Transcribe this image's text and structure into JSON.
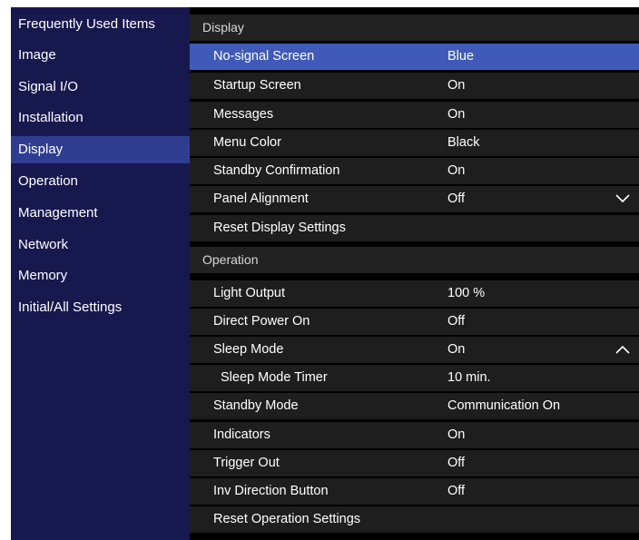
{
  "sidebar": {
    "items": [
      {
        "label": "Frequently Used Items",
        "active": false
      },
      {
        "label": "Image",
        "active": false
      },
      {
        "label": "Signal I/O",
        "active": false
      },
      {
        "label": "Installation",
        "active": false
      },
      {
        "label": "Display",
        "active": true
      },
      {
        "label": "Operation",
        "active": false
      },
      {
        "label": "Management",
        "active": false
      },
      {
        "label": "Network",
        "active": false
      },
      {
        "label": "Memory",
        "active": false
      },
      {
        "label": "Initial/All Settings",
        "active": false
      }
    ]
  },
  "display": {
    "header": "Display",
    "rows": [
      {
        "label": "No-signal Screen",
        "value": "Blue",
        "selected": true
      },
      {
        "label": "Startup Screen",
        "value": "On"
      },
      {
        "label": "Messages",
        "value": "On"
      },
      {
        "label": "Menu Color",
        "value": "Black"
      },
      {
        "label": "Standby Confirmation",
        "value": "On"
      },
      {
        "label": "Panel Alignment",
        "value": "Off",
        "icon": "chevron-down-icon"
      },
      {
        "label": "Reset Display Settings",
        "value": ""
      }
    ]
  },
  "operation": {
    "header": "Operation",
    "rows": [
      {
        "label": "Light Output",
        "value": "100 %"
      },
      {
        "label": "Direct Power On",
        "value": "Off"
      },
      {
        "label": "Sleep Mode",
        "value": "On",
        "icon": "chevron-up-icon"
      },
      {
        "label": "Sleep Mode Timer",
        "value": "10 min.",
        "sub": true
      },
      {
        "label": "Standby Mode",
        "value": "Communication On"
      },
      {
        "label": "Indicators",
        "value": "On"
      },
      {
        "label": "Trigger Out",
        "value": "Off"
      },
      {
        "label": "Inv Direction Button",
        "value": "Off"
      },
      {
        "label": "Reset Operation Settings",
        "value": ""
      }
    ]
  },
  "colors": {
    "sidebar_bg": "#17184e",
    "sidebar_active": "#2f3d91",
    "row_bg": "#1e1e1e",
    "row_selected": "#3f5ab8",
    "header_bg": "#222222"
  }
}
